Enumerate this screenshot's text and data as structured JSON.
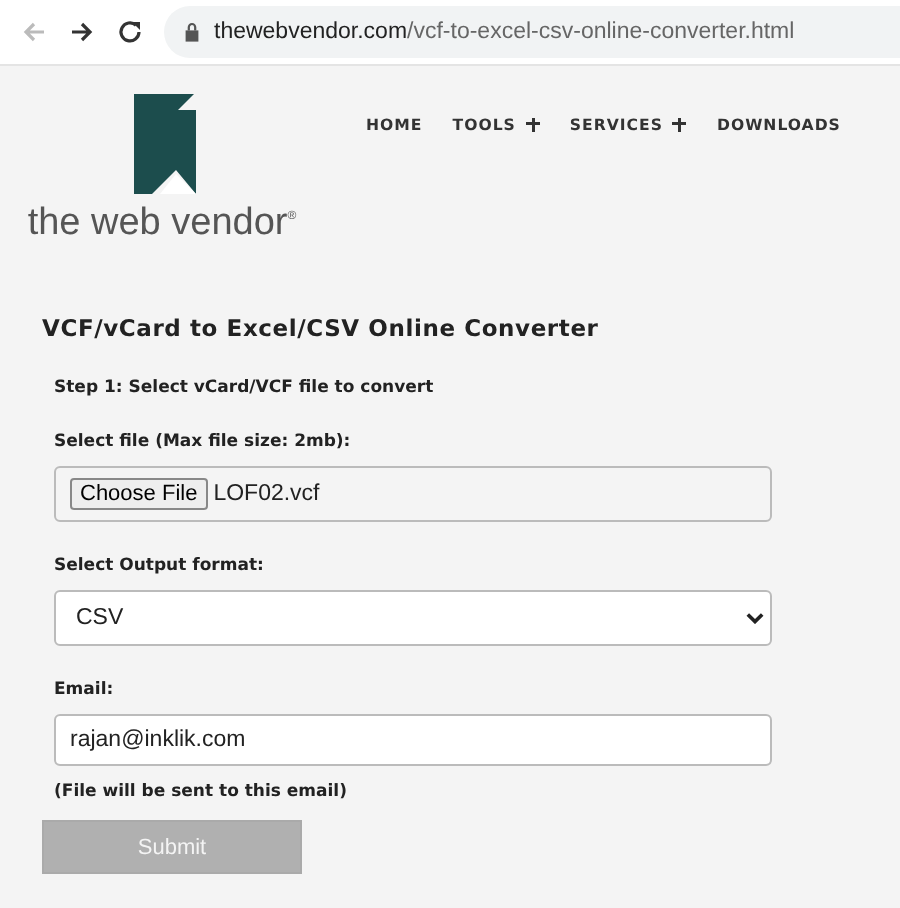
{
  "browser": {
    "url_host": "thewebvendor.com",
    "url_path": "/vcf-to-excel-csv-online-converter.html"
  },
  "logo": {
    "text": "the web vendor",
    "mark": "®"
  },
  "nav": [
    {
      "label": "HOME",
      "dropdown": false
    },
    {
      "label": "TOOLS",
      "dropdown": true
    },
    {
      "label": "SERVICES",
      "dropdown": true
    },
    {
      "label": "DOWNLOADS",
      "dropdown": false
    }
  ],
  "title": "VCF/vCard to Excel/CSV Online Converter",
  "step": "Step 1: Select vCard/VCF file to convert",
  "file": {
    "label": "Select file (Max file size: 2mb):",
    "button": "Choose File",
    "value": "LOF02.vcf"
  },
  "format": {
    "label": "Select Output format:",
    "value": "CSV"
  },
  "email": {
    "label": "Email:",
    "value": "rajan@inklik.com",
    "note": "(File will be sent to this email)"
  },
  "submit": {
    "label": "Submit",
    "disabled": true
  }
}
